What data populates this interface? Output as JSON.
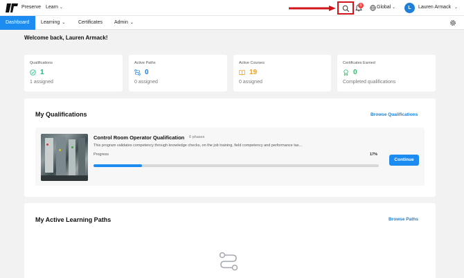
{
  "brand": {
    "name": "Preserve",
    "learn_label": "Learn"
  },
  "header": {
    "global_label": "Global",
    "notification_count": "0",
    "user": {
      "initial": "L",
      "name": "Lauren Armack"
    }
  },
  "nav": {
    "tabs": [
      {
        "label": "Dashboard"
      },
      {
        "label": "Learning"
      },
      {
        "label": "Certificates"
      },
      {
        "label": "Admin"
      }
    ]
  },
  "welcome": "Welcome back, Lauren Armack!",
  "stats": [
    {
      "label": "Qualifications",
      "value": "1",
      "sub": "1 assigned",
      "color": "#10b981",
      "icon": "check-circle-icon"
    },
    {
      "label": "Active Paths",
      "value": "0",
      "sub": "0 assigned",
      "color": "#1d7fd8",
      "icon": "path-icon"
    },
    {
      "label": "Active Courses",
      "value": "19",
      "sub": "0 assigned",
      "color": "#f59e0b",
      "icon": "book-icon"
    },
    {
      "label": "Certificates Earned",
      "value": "0",
      "sub": "Completed qualifications",
      "color": "#22c55e",
      "icon": "award-icon"
    }
  ],
  "qualifications": {
    "title": "My Qualifications",
    "link": "Browse Qualifications",
    "item": {
      "title": "Control Room Operator Qualification",
      "phases": "6 phases",
      "description": "This program validates competency through knowledge checks, on the job training, field competency and performance tas...",
      "progress_label": "Progress",
      "progress_text": "17%",
      "progress": 0.17,
      "button": "Continue"
    }
  },
  "paths": {
    "title": "My Active Learning Paths",
    "link": "Browse Paths"
  },
  "colors": {
    "accent": "#1d8cf0",
    "annotation": "#d2151b"
  }
}
